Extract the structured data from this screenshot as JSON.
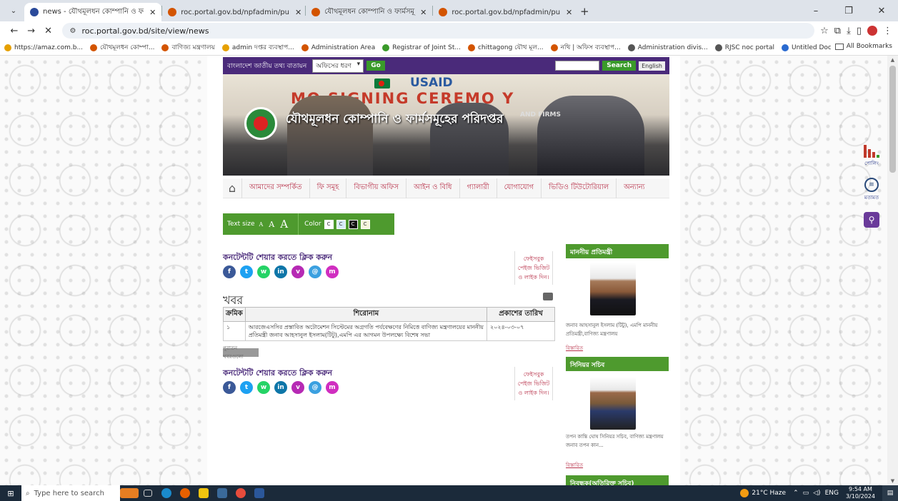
{
  "browser": {
    "tabs": [
      {
        "label": "news - যৌথমূলধন কোম্পানি ও ফ",
        "active": true,
        "color": "#2a4a9a"
      },
      {
        "label": "roc.portal.gov.bd/npfadmin/pu",
        "active": false,
        "color": "#d35400"
      },
      {
        "label": "যৌথমূলধন কোম্পানি ও ফার্মসমূ",
        "active": false,
        "color": "#d35400"
      },
      {
        "label": "roc.portal.gov.bd/npfadmin/pu",
        "active": false,
        "color": "#d35400"
      }
    ],
    "new_tab": "+",
    "url": "roc.portal.gov.bd/site/view/news",
    "bookmarks": [
      {
        "label": "https://amaz.com.b...",
        "color": "#e6a000"
      },
      {
        "label": "যৌথমূলধন কোম্পা...",
        "color": "#d35400"
      },
      {
        "label": "বাণিজ্য মন্ত্রণালয়",
        "color": "#d35400"
      },
      {
        "label": "admin দপ্তর ব্যবস্থাপ...",
        "color": "#e6a000"
      },
      {
        "label": "Administration Area",
        "color": "#d35400"
      },
      {
        "label": "Registrar of Joint St...",
        "color": "#3a9a2a"
      },
      {
        "label": "chittagong যৌথ মূল...",
        "color": "#d35400"
      },
      {
        "label": "নথি | অফিস ব্যবস্থাপ...",
        "color": "#d35400"
      },
      {
        "label": "Administration divis...",
        "color": "#555555"
      },
      {
        "label": "RJSC noc portal",
        "color": "#555555"
      },
      {
        "label": "Untitled Docs - Goo...",
        "color": "#2a6ad0"
      }
    ],
    "all_bookmarks": "All Bookmarks"
  },
  "site": {
    "portal_label": "বাংলাদেশ জাতীয় তথ্য বাতায়ন",
    "office_select": "অফিসের ধরণ",
    "go": "Go",
    "search": "Search",
    "lang": "English",
    "banner": {
      "usaid": "USAID",
      "ceremony": "MO  SIGNING  CEREMO Y",
      "org_title": "যৌথমূলধন কোম্পানি ও ফার্মসমূহের পরিদপ্তর",
      "and_firms": "AND FIRMS"
    },
    "nav": [
      "আমাদের সম্পর্কিত",
      "ফি সমূহ",
      "বিভাগীয় অফিস",
      "আইন ও বিধি",
      "গ্যালারী",
      "যোগাযোগ",
      "ভিডিও টিউটোরিয়াল",
      "অন্যান্য"
    ],
    "accessibility": {
      "text_size_label": "Text size",
      "sizes": [
        "A",
        "A",
        "A"
      ],
      "color_label": "Color",
      "colors": [
        {
          "label": "C",
          "bg": "#ffffff",
          "fg": "#333333"
        },
        {
          "label": "C",
          "bg": "#d6eaf8",
          "fg": "#333333"
        },
        {
          "label": "C",
          "bg": "#111111",
          "fg": "#ffffff"
        },
        {
          "label": "C",
          "bg": "#f5f5dc",
          "fg": "#333333"
        }
      ]
    },
    "share_title": "কনটেন্টটি শেয়ার করতে ক্লিক করুন",
    "share_icons": [
      {
        "glyph": "f",
        "color": "#3b5998",
        "name": "facebook-icon"
      },
      {
        "glyph": "t",
        "color": "#1da1f2",
        "name": "twitter-icon"
      },
      {
        "glyph": "w",
        "color": "#25d366",
        "name": "whatsapp-icon"
      },
      {
        "glyph": "in",
        "color": "#0e76a8",
        "name": "linkedin-icon"
      },
      {
        "glyph": "v",
        "color": "#b62ab4",
        "name": "viber-icon"
      },
      {
        "glyph": "@",
        "color": "#3ba0e0",
        "name": "link-icon"
      },
      {
        "glyph": "m",
        "color": "#d02ec0",
        "name": "messenger-icon"
      }
    ],
    "fb_like": "ফেইসবুক পেইজ ভিজিট ও লাইক দিন।",
    "news_heading": "খবর",
    "table": {
      "headers": [
        "ক্রমিক",
        "শিরোনাম",
        "প্রকাশের তারিখ"
      ],
      "rows": [
        {
          "serial": "১",
          "title": "আরজেএসসির প্রস্তাবিত অটোমেশন সিস্টেমের অগ্রগতি পর্যবেক্ষণের নিমিত্তে বাণিজ্য মন্ত্রণালয়ের মাননীয় প্রতিমন্ত্রী জনাব আহসানুল ইসলাম(টিটু),এমপি এর আগমন উপলক্ষ্যে বিশেষ সভা",
          "date": "২০২৪-০৩-০৭"
        }
      ]
    },
    "archive": "পুরাতন খবরগুলো",
    "sidebar": [
      {
        "heading": "মাননীয় প্রতিমন্ত্রী",
        "text": "জনাব আহসানুল ইসলাম (টিটু), এমপি মাননীয় প্রতিমন্ত্রী,বাণিজ্য মন্ত্রণালয়",
        "link": "বিস্তারিত"
      },
      {
        "heading": "সিনিয়র সচিব",
        "text": "তপন কান্তি ঘোষ সিনিয়র সচিব, বাণিজ্য মন্ত্রণালয় জনাব তপন কান...",
        "link": "বিস্তারিত"
      },
      {
        "heading": "নিবন্ধক(অতিরিক্ত সচিব)"
      }
    ]
  },
  "widgets": {
    "poll": "পোলিং",
    "feedback": "মতামত"
  },
  "taskbar": {
    "search_placeholder": "Type here to search",
    "weather": "21°C Haze",
    "lang": "ENG",
    "time": "9:54 AM",
    "date": "3/10/2024"
  }
}
